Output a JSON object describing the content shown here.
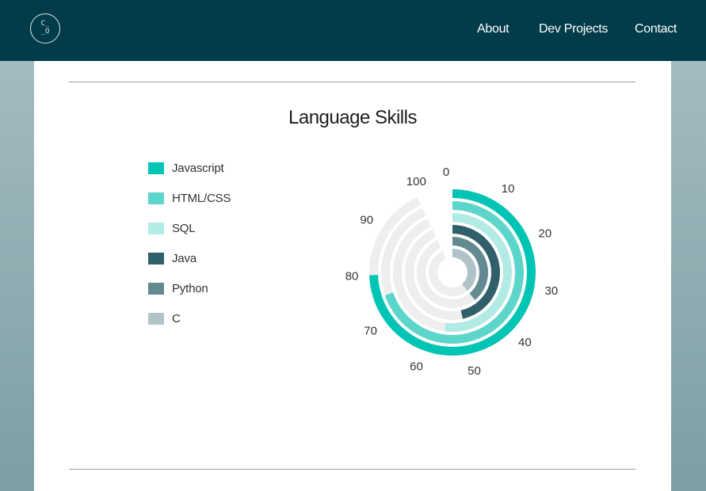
{
  "header": {
    "logo_line1": "C_",
    "logo_line2": "_O",
    "nav": [
      "About",
      "Dev Projects",
      "Contact"
    ]
  },
  "chart_data": {
    "type": "radial-bar",
    "title": "Language Skills",
    "scale": [
      0,
      100
    ],
    "ticks": [
      0,
      10,
      20,
      30,
      40,
      50,
      60,
      70,
      80,
      90,
      100
    ],
    "series": [
      {
        "name": "Javascript",
        "value": 80,
        "color": "#00c4b4"
      },
      {
        "name": "HTML/CSS",
        "value": 75,
        "color": "#5cd6ca"
      },
      {
        "name": "SQL",
        "value": 56,
        "color": "#b2ebe5"
      },
      {
        "name": "Java",
        "value": 50,
        "color": "#2f5f6a"
      },
      {
        "name": "Python",
        "value": 42,
        "color": "#648a91"
      },
      {
        "name": "C",
        "value": 42,
        "color": "#b0c3c7"
      }
    ],
    "track_color": "#eeeeee"
  }
}
